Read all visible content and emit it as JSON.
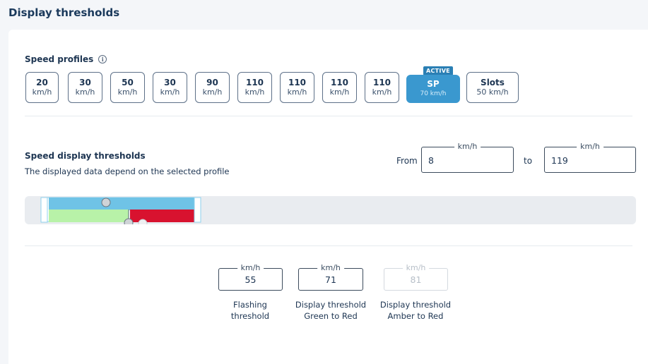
{
  "page_title": "Display thresholds",
  "speed_profiles": {
    "title": "Speed profiles",
    "info_icon": "info-circle-icon",
    "active_badge": "ACTIVE",
    "items": [
      {
        "value": "20",
        "unit": "km/h"
      },
      {
        "value": "30",
        "unit": "km/h"
      },
      {
        "value": "50",
        "unit": "km/h"
      },
      {
        "value": "30",
        "unit": "km/h"
      },
      {
        "value": "90",
        "unit": "km/h"
      },
      {
        "value": "110",
        "unit": "km/h"
      },
      {
        "value": "110",
        "unit": "km/h"
      },
      {
        "value": "110",
        "unit": "km/h"
      },
      {
        "value": "110",
        "unit": "km/h"
      },
      {
        "value": "SP",
        "unit": "70 km/h",
        "active": true
      },
      {
        "value": "Slots",
        "unit": "50 km/h"
      }
    ]
  },
  "speed_display": {
    "title": "Speed display thresholds",
    "description": "The displayed data depend on the selected profile",
    "from_label": "From",
    "to_label": "to",
    "from_unit": "km/h",
    "from_value": "8",
    "to_unit": "km/h",
    "to_value": "119"
  },
  "thresholds": [
    {
      "unit": "km/h",
      "value": "55",
      "caption_line1": "Flashing",
      "caption_line2": "threshold",
      "disabled": false
    },
    {
      "unit": "km/h",
      "value": "71",
      "caption_line1": "Display threshold",
      "caption_line2": "Green to Red",
      "disabled": false
    },
    {
      "unit": "km/h",
      "value": "81",
      "caption_line1": "Display threshold",
      "caption_line2": "Amber to Red",
      "disabled": true
    }
  ],
  "colors": {
    "accent": "#3a98cf",
    "range_blue": "#6fc3e6",
    "green": "#b8f2a8",
    "red": "#d8122f"
  }
}
